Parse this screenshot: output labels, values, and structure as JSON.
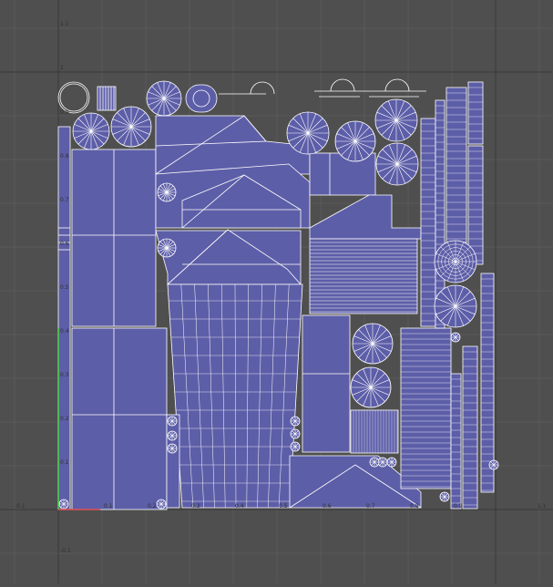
{
  "editor": {
    "colors": {
      "background": "#4f4f4f",
      "grid": "#5d5d5d",
      "axis_line": "#3a3a3a",
      "uv_fill": "#5d5ea8",
      "uv_edge": "#ffffff",
      "axis_v": "#4cd64c",
      "axis_u": "#e05050",
      "label": "#303030"
    },
    "axis_labels": {
      "top_v": "1.1",
      "v_one": "1",
      "bottom_v": "-0.1",
      "left_u": "-0.1",
      "right_u": "1.1",
      "u_ticks": [
        "0.1",
        "0.2",
        "0.3",
        "0.4",
        "0.5",
        "0.6",
        "0.7",
        "0.8",
        "0.9"
      ],
      "v_ticks": [
        "0.9",
        "0.8",
        "0.7",
        "0.6",
        "0.5",
        "0.4",
        "0.3",
        "0.2",
        "0.1"
      ]
    }
  }
}
